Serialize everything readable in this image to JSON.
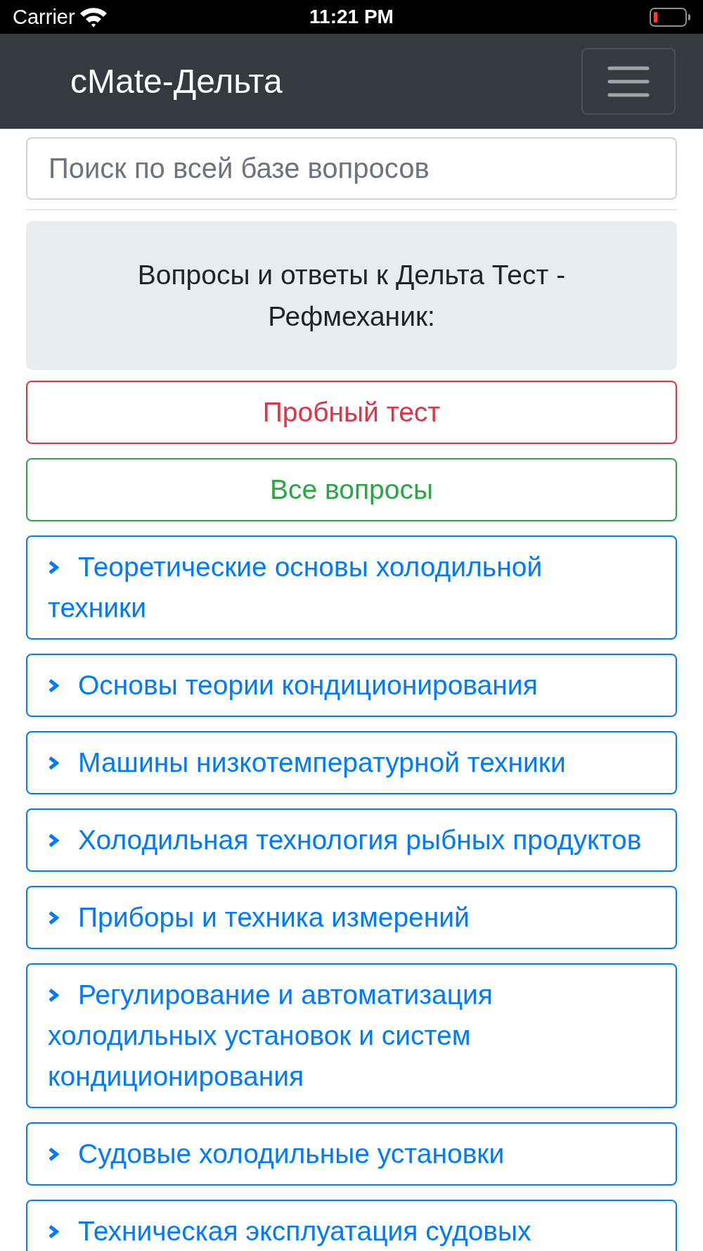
{
  "status_bar": {
    "carrier": "Carrier",
    "time": "11:21 PM"
  },
  "navbar": {
    "brand": "cMate-Дельта"
  },
  "search": {
    "placeholder": "Поиск по всей базе вопросов"
  },
  "jumbotron": {
    "text": "Вопросы и ответы к Дельта Тест - Рефмеханик:"
  },
  "buttons": [
    {
      "label": "Пробный тест",
      "kind": "danger"
    },
    {
      "label": "Все вопросы",
      "kind": "success"
    }
  ],
  "categories": [
    {
      "label": "Теоретические основы холодильной техники",
      "expanded": false
    },
    {
      "label": "Основы теории кондиционирования",
      "expanded": false
    },
    {
      "label": "Машины низкотемпературной техники",
      "expanded": false
    },
    {
      "label": "Холодильная технология рыбных продуктов",
      "expanded": false
    },
    {
      "label": "Приборы и техника измерений",
      "expanded": false
    },
    {
      "label": "Регулирование и автоматизация холодильных установок и систем кондиционирования",
      "expanded": false
    },
    {
      "label": "Судовые холодильные установки",
      "expanded": false
    },
    {
      "label": "Техническая эксплуатация судовых",
      "expanded": false
    }
  ]
}
